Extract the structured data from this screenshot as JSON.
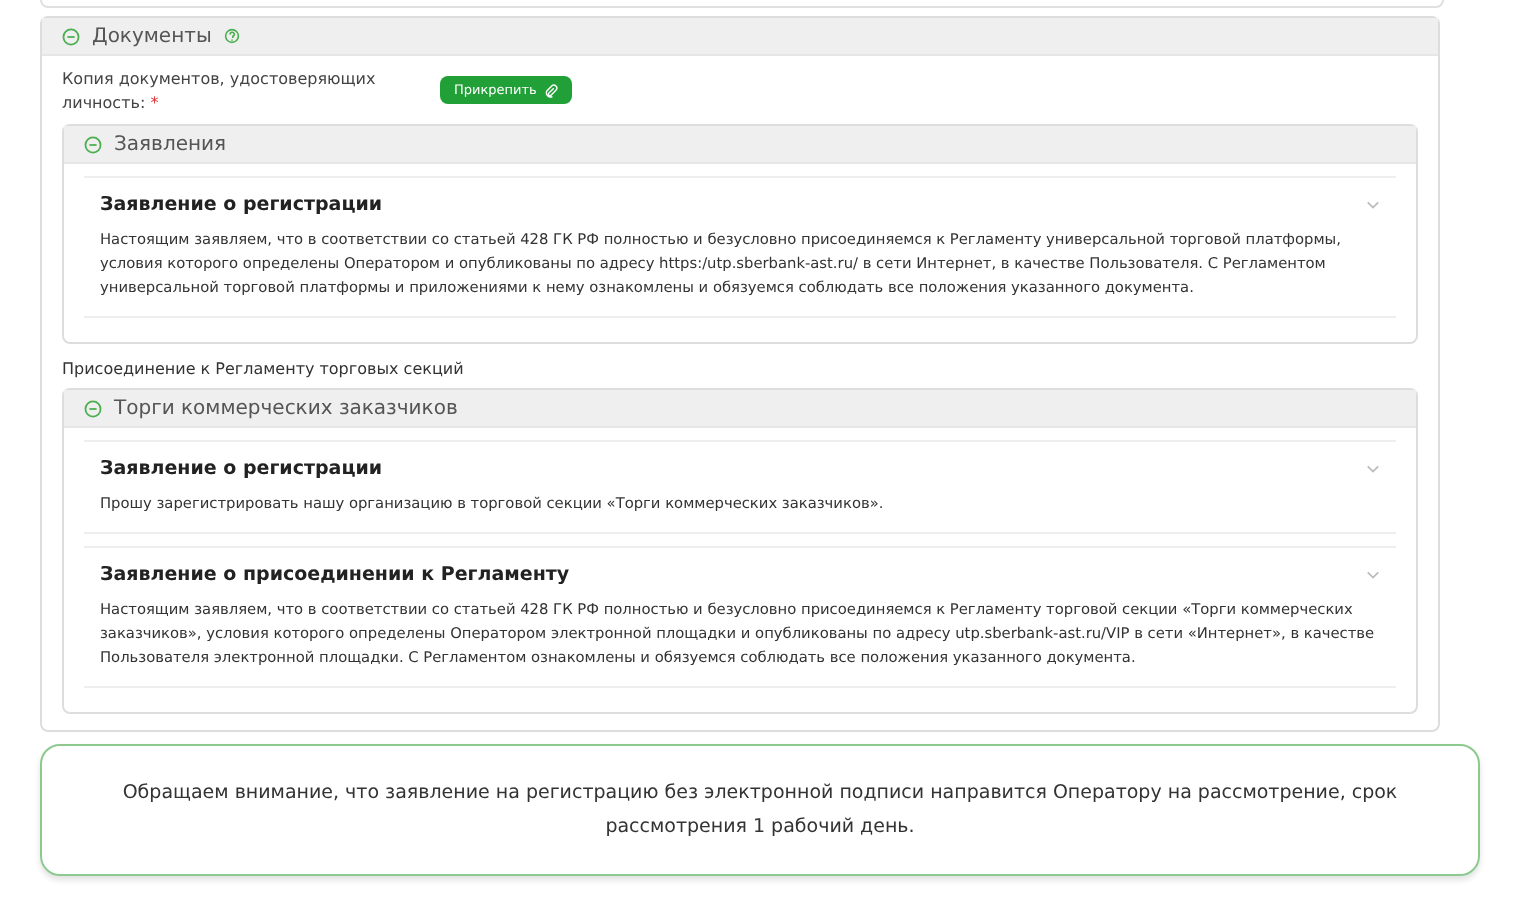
{
  "documents": {
    "title": "Документы",
    "expanded": true,
    "attachment": {
      "label": "Копия документов, удостоверяющих личность:",
      "required_mark": "*",
      "button": "Прикрепить"
    },
    "groups": [
      {
        "title": "Заявления",
        "expanded": true,
        "items": [
          {
            "title": "Заявление о регистрации",
            "text": "Настоящим заявляем, что в соответствии со статьей 428 ГК РФ полностью и безусловно присоединяемся к Регламенту универсальной торговой платформы, условия которого определены Оператором и опубликованы по адресу https:/utp.sberbank-ast.ru/ в сети Интернет, в качестве Пользователя. С Регламентом универсальной торговой платформы и приложениями к нему ознакомлены и обязуемся соблюдать все положения указанного документа."
          }
        ]
      },
      {
        "caption": "Присоединение к Регламенту торговых секций",
        "title": "Торги коммерческих заказчиков",
        "expanded": true,
        "items": [
          {
            "title": "Заявление о регистрации",
            "text": "Прошу зарегистрировать нашу организацию в торговой секции «Торги коммерческих заказчиков»."
          },
          {
            "title": "Заявление о присоединении к Регламенту",
            "text": "Настоящим заявляем, что в соответствии со статьей 428 ГК РФ полностью и безусловно присоединяемся к Регламенту торговой секции «Торги коммерческих заказчиков», условия которого определены Оператором электронной площадки и опубликованы по адресу utp.sberbank-ast.ru/VIP в сети «Интернет», в качестве Пользователя электронной площадки. С Регламентом ознакомлены и обязуемся соблюдать все положения указанного документа."
          }
        ]
      }
    ]
  },
  "notice": "Обращаем внимание, что заявление на регистрацию без электронной подписи направится Оператору на рассмотрение, срок рассмотрения 1 рабочий день."
}
